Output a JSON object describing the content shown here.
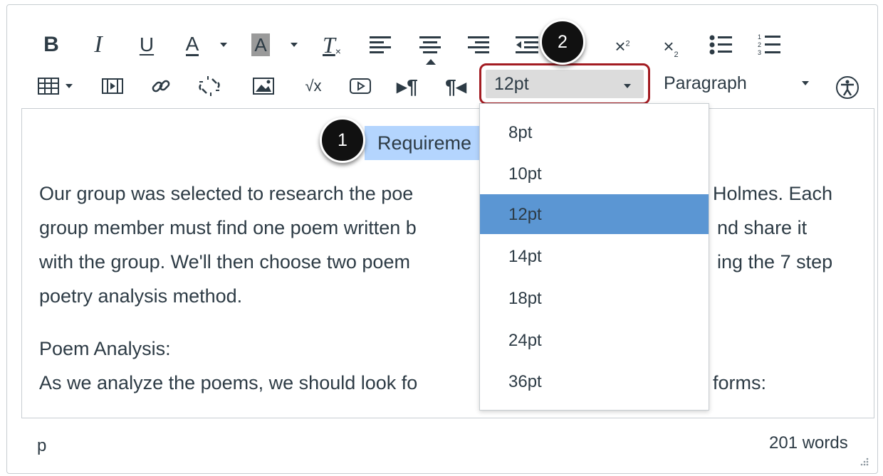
{
  "toolbar": {
    "bold_label": "B",
    "italic_label": "I",
    "underline_label": "U",
    "font_color_label": "A",
    "highlight_label": "A",
    "clear_format_label": "T",
    "font_size": {
      "value": "12pt"
    },
    "block_format": {
      "value": "Paragraph"
    }
  },
  "editor": {
    "selected_text": "Requireme",
    "paragraph1": {
      "line1_left": "Our group was selected to research the poe",
      "line1_right": "Holmes. Each",
      "line2_left": "group member must find one poem written b",
      "line2_right": "nd share it",
      "line3_left": "with the group. We'll then choose two poem",
      "line3_right": "ing the 7 step",
      "line4": "poetry analysis method."
    },
    "heading": "Poem Analysis:",
    "line5_left": "As we analyze the poems, we should look fo",
    "line5_right": "forms:"
  },
  "font_size_dropdown": {
    "options": [
      "8pt",
      "10pt",
      "12pt",
      "14pt",
      "18pt",
      "24pt",
      "36pt"
    ],
    "selected": "12pt"
  },
  "callouts": {
    "one": "1",
    "two": "2"
  },
  "status_bar": {
    "element_path": "p",
    "word_count": "201 words"
  },
  "colors": {
    "accent_selected": "#5b96d3",
    "callout_outline": "#a31c22",
    "text_highlight": "#b4d5fe"
  }
}
